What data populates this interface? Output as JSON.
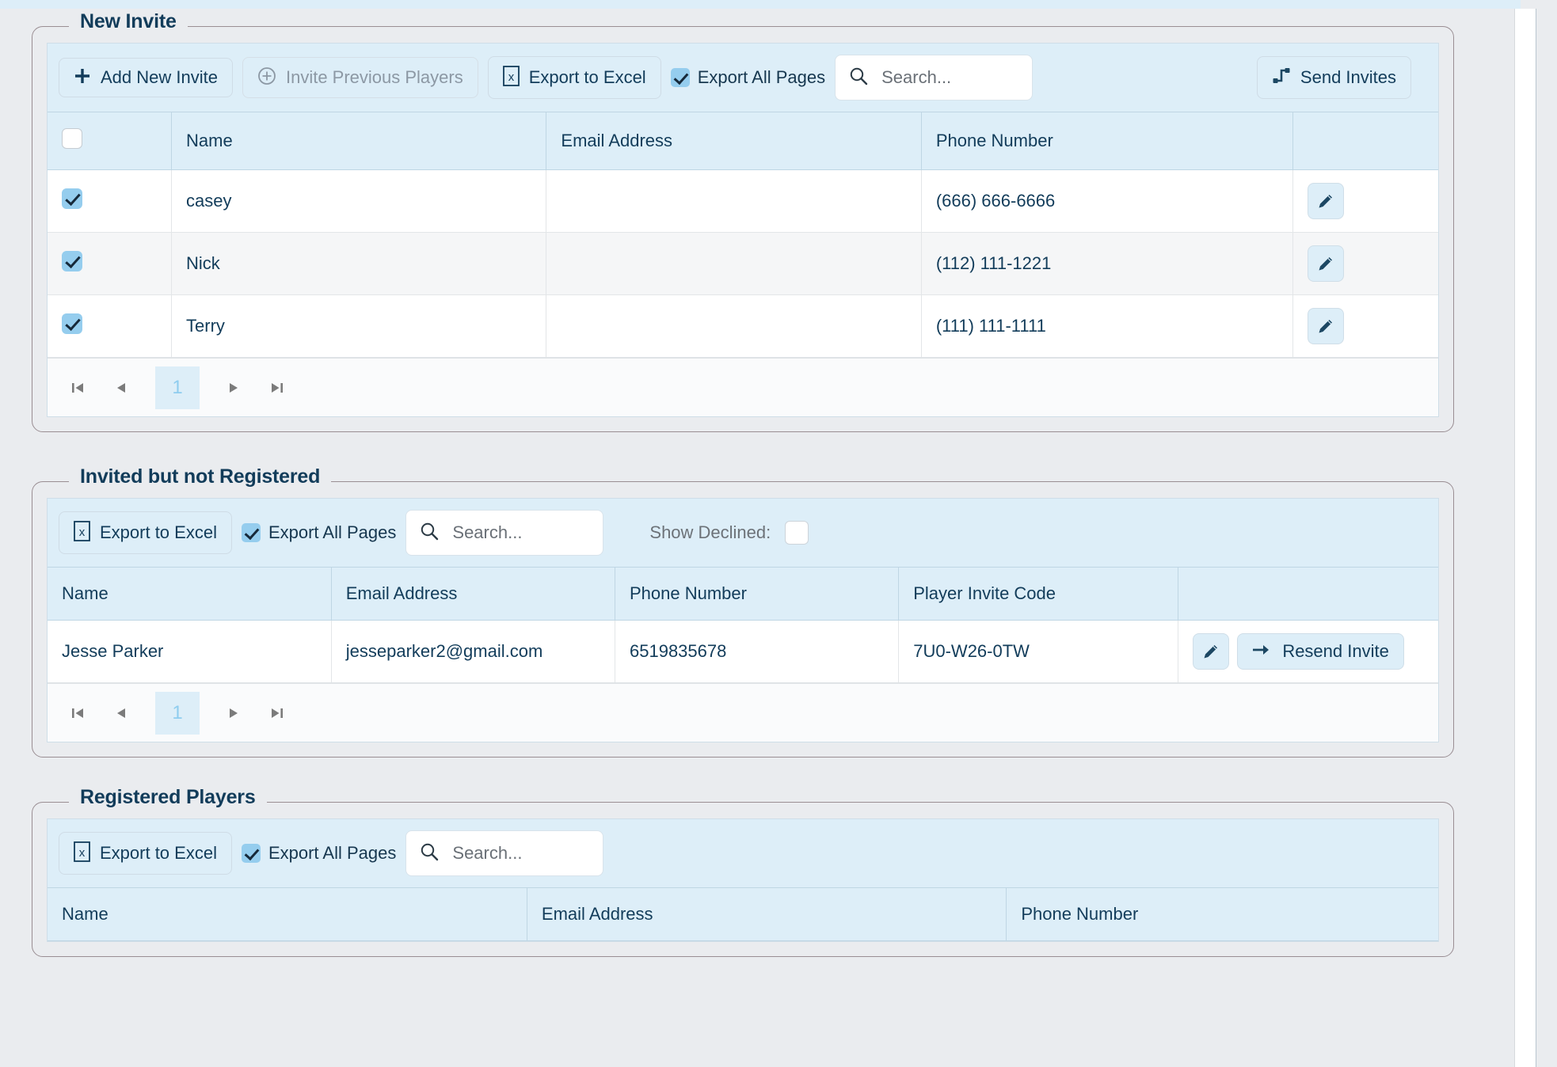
{
  "sections": [
    {
      "legend": "New Invite",
      "toolbar": {
        "add_new_invite": "Add New Invite",
        "invite_previous_players": "Invite Previous Players",
        "export_to_excel": "Export to Excel",
        "export_all_pages": "Export All Pages",
        "search_placeholder": "Search...",
        "send_invites": "Send Invites"
      },
      "columns": [
        "",
        "Name",
        "Email Address",
        "Phone Number",
        ""
      ],
      "rows": [
        {
          "checked": true,
          "name": "casey",
          "email": "",
          "phone": "(666) 666-6666"
        },
        {
          "checked": true,
          "name": "Nick",
          "email": "",
          "phone": "(112) 111-1221"
        },
        {
          "checked": true,
          "name": "Terry",
          "email": "",
          "phone": "(111) 111-1111"
        }
      ],
      "pager": {
        "page": "1"
      }
    },
    {
      "legend": "Invited but not Registered",
      "toolbar": {
        "export_to_excel": "Export to Excel",
        "export_all_pages": "Export All Pages",
        "search_placeholder": "Search...",
        "show_declined_label": "Show Declined:"
      },
      "columns": [
        "Name",
        "Email Address",
        "Phone Number",
        "Player Invite Code",
        ""
      ],
      "rows": [
        {
          "name": "Jesse Parker",
          "email": "jesseparker2@gmail.com",
          "phone": "6519835678",
          "invite_code": "7U0-W26-0TW",
          "resend_label": "Resend Invite"
        }
      ],
      "pager": {
        "page": "1"
      }
    },
    {
      "legend": "Registered Players",
      "toolbar": {
        "export_to_excel": "Export to Excel",
        "export_all_pages": "Export All Pages",
        "search_placeholder": "Search..."
      },
      "columns": [
        "Name",
        "Email Address",
        "Phone Number"
      ],
      "rows": []
    }
  ],
  "colors": {
    "toolbar_bg": "#ddeef8",
    "header_bg": "#ddeef8",
    "page_bg": "#eaecef",
    "text_primary": "#123c5a",
    "checkbox_accent": "#95cdee",
    "pager_active_text": "#8fcdef"
  },
  "icons": {
    "plus": "plus-icon",
    "plus_circle": "plus-circle-icon",
    "excel": "excel-file-icon",
    "search": "search-icon",
    "share": "share-icon",
    "pencil": "pencil-icon",
    "arrow_right": "arrow-right-icon",
    "first_page": "first-page-icon",
    "prev_page": "prev-page-icon",
    "next_page": "next-page-icon",
    "last_page": "last-page-icon"
  }
}
